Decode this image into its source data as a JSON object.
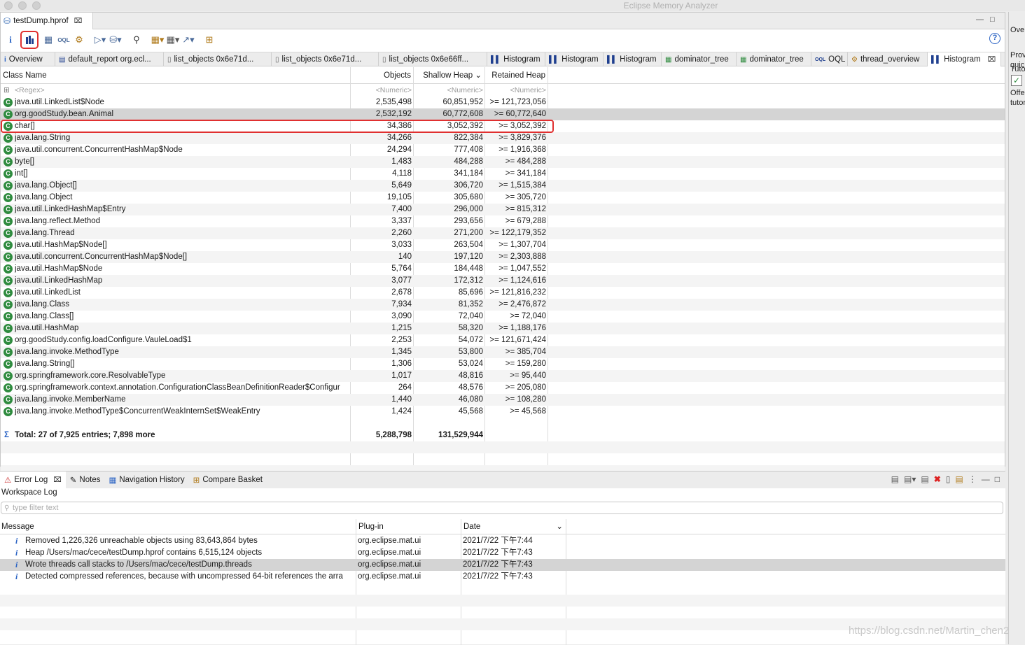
{
  "window": {
    "app_title": "Eclipse Memory Analyzer"
  },
  "editor": {
    "file_tab": "testDump.hprof",
    "view_tabs": [
      {
        "label": "Overview",
        "icon": "info-icon"
      },
      {
        "label": "default_report  org.ecl...",
        "icon": "report-icon"
      },
      {
        "label": "list_objects  0x6e71d...",
        "icon": "page-icon"
      },
      {
        "label": "list_objects  0x6e71d...",
        "icon": "page-icon"
      },
      {
        "label": "list_objects  0x6e66ff...",
        "icon": "page-icon"
      },
      {
        "label": "Histogram",
        "icon": "histogram-icon"
      },
      {
        "label": "Histogram",
        "icon": "histogram-icon"
      },
      {
        "label": "Histogram",
        "icon": "histogram-icon"
      },
      {
        "label": "dominator_tree",
        "icon": "tree-icon"
      },
      {
        "label": "dominator_tree",
        "icon": "tree-icon"
      },
      {
        "label": "OQL",
        "icon": "oql-icon"
      },
      {
        "label": "thread_overview",
        "icon": "gear-icon"
      },
      {
        "label": "Histogram",
        "icon": "histogram-icon"
      }
    ]
  },
  "histogram": {
    "columns": {
      "class_name": "Class Name",
      "objects": "Objects",
      "shallow": "Shallow Heap",
      "retained": "Retained Heap"
    },
    "filter": {
      "name": "<Regex>",
      "objects": "<Numeric>",
      "shallow": "<Numeric>",
      "retained": "<Numeric>"
    },
    "rows": [
      {
        "name": "java.util.LinkedList$Node",
        "objects": "2,535,498",
        "shallow": "60,851,952",
        "retained": ">= 121,723,056"
      },
      {
        "name": "org.goodStudy.bean.Animal",
        "objects": "2,532,192",
        "shallow": "60,772,608",
        "retained": ">= 60,772,640"
      },
      {
        "name": "char[]",
        "objects": "34,386",
        "shallow": "3,052,392",
        "retained": ">= 3,052,392"
      },
      {
        "name": "java.lang.String",
        "objects": "34,266",
        "shallow": "822,384",
        "retained": ">= 3,829,376"
      },
      {
        "name": "java.util.concurrent.ConcurrentHashMap$Node",
        "objects": "24,294",
        "shallow": "777,408",
        "retained": ">= 1,916,368"
      },
      {
        "name": "byte[]",
        "objects": "1,483",
        "shallow": "484,288",
        "retained": ">= 484,288"
      },
      {
        "name": "int[]",
        "objects": "4,118",
        "shallow": "341,184",
        "retained": ">= 341,184"
      },
      {
        "name": "java.lang.Object[]",
        "objects": "5,649",
        "shallow": "306,720",
        "retained": ">= 1,515,384"
      },
      {
        "name": "java.lang.Object",
        "objects": "19,105",
        "shallow": "305,680",
        "retained": ">= 305,720"
      },
      {
        "name": "java.util.LinkedHashMap$Entry",
        "objects": "7,400",
        "shallow": "296,000",
        "retained": ">= 815,312"
      },
      {
        "name": "java.lang.reflect.Method",
        "objects": "3,337",
        "shallow": "293,656",
        "retained": ">= 679,288"
      },
      {
        "name": "java.lang.Thread",
        "objects": "2,260",
        "shallow": "271,200",
        "retained": ">= 122,179,352"
      },
      {
        "name": "java.util.HashMap$Node[]",
        "objects": "3,033",
        "shallow": "263,504",
        "retained": ">= 1,307,704"
      },
      {
        "name": "java.util.concurrent.ConcurrentHashMap$Node[]",
        "objects": "140",
        "shallow": "197,120",
        "retained": ">= 2,303,888"
      },
      {
        "name": "java.util.HashMap$Node",
        "objects": "5,764",
        "shallow": "184,448",
        "retained": ">= 1,047,552"
      },
      {
        "name": "java.util.LinkedHashMap",
        "objects": "3,077",
        "shallow": "172,312",
        "retained": ">= 1,124,616"
      },
      {
        "name": "java.util.LinkedList",
        "objects": "2,678",
        "shallow": "85,696",
        "retained": ">= 121,816,232"
      },
      {
        "name": "java.lang.Class",
        "objects": "7,934",
        "shallow": "81,352",
        "retained": ">= 2,476,872"
      },
      {
        "name": "java.lang.Class[]",
        "objects": "3,090",
        "shallow": "72,040",
        "retained": ">= 72,040"
      },
      {
        "name": "java.util.HashMap",
        "objects": "1,215",
        "shallow": "58,320",
        "retained": ">= 1,188,176"
      },
      {
        "name": "org.goodStudy.config.loadConfigure.VauleLoad$1",
        "objects": "2,253",
        "shallow": "54,072",
        "retained": ">= 121,671,424"
      },
      {
        "name": "java.lang.invoke.MethodType",
        "objects": "1,345",
        "shallow": "53,800",
        "retained": ">= 385,704"
      },
      {
        "name": "java.lang.String[]",
        "objects": "1,306",
        "shallow": "53,024",
        "retained": ">= 159,280"
      },
      {
        "name": "org.springframework.core.ResolvableType",
        "objects": "1,017",
        "shallow": "48,816",
        "retained": ">= 95,440"
      },
      {
        "name": "org.springframework.context.annotation.ConfigurationClassBeanDefinitionReader$Configur",
        "objects": "264",
        "shallow": "48,576",
        "retained": ">= 205,080"
      },
      {
        "name": "java.lang.invoke.MemberName",
        "objects": "1,440",
        "shallow": "46,080",
        "retained": ">= 108,280"
      },
      {
        "name": "java.lang.invoke.MethodType$ConcurrentWeakInternSet$WeakEntry",
        "objects": "1,424",
        "shallow": "45,568",
        "retained": ">= 45,568"
      }
    ],
    "total": {
      "name": "Total: 27 of 7,925 entries; 7,898 more",
      "objects": "5,288,798",
      "shallow": "131,529,944"
    },
    "highlight_color": "#e03030"
  },
  "bottom": {
    "tabs": [
      {
        "label": "Error Log",
        "icon": "error-log-icon"
      },
      {
        "label": "Notes",
        "icon": "notes-icon"
      },
      {
        "label": "Navigation History",
        "icon": "navigation-icon"
      },
      {
        "label": "Compare Basket",
        "icon": "basket-icon"
      }
    ],
    "workspace_log": "Workspace Log",
    "filter_placeholder": "type filter text",
    "columns": {
      "message": "Message",
      "plugin": "Plug-in",
      "date": "Date"
    },
    "rows": [
      {
        "message": "Removed 1,226,326 unreachable objects using 83,643,864 bytes",
        "plugin": "org.eclipse.mat.ui",
        "date": "2021/7/22 下午7:44"
      },
      {
        "message": "Heap /Users/mac/cece/testDump.hprof contains 6,515,124 objects",
        "plugin": "org.eclipse.mat.ui",
        "date": "2021/7/22 下午7:43"
      },
      {
        "message": "Wrote threads call stacks to /Users/mac/cece/testDump.threads",
        "plugin": "org.eclipse.mat.ui",
        "date": "2021/7/22 下午7:43"
      },
      {
        "message": "Detected compressed references, because with uncompressed 64-bit references the arra",
        "plugin": "org.eclipse.mat.ui",
        "date": "2021/7/22 下午7:43"
      }
    ]
  },
  "right_strip": {
    "texts": [
      "Ove",
      "Prov",
      "quic",
      "Tuto",
      "Offe",
      "tutor"
    ]
  },
  "watermark": "https://blog.csdn.net/Martin_chen2"
}
